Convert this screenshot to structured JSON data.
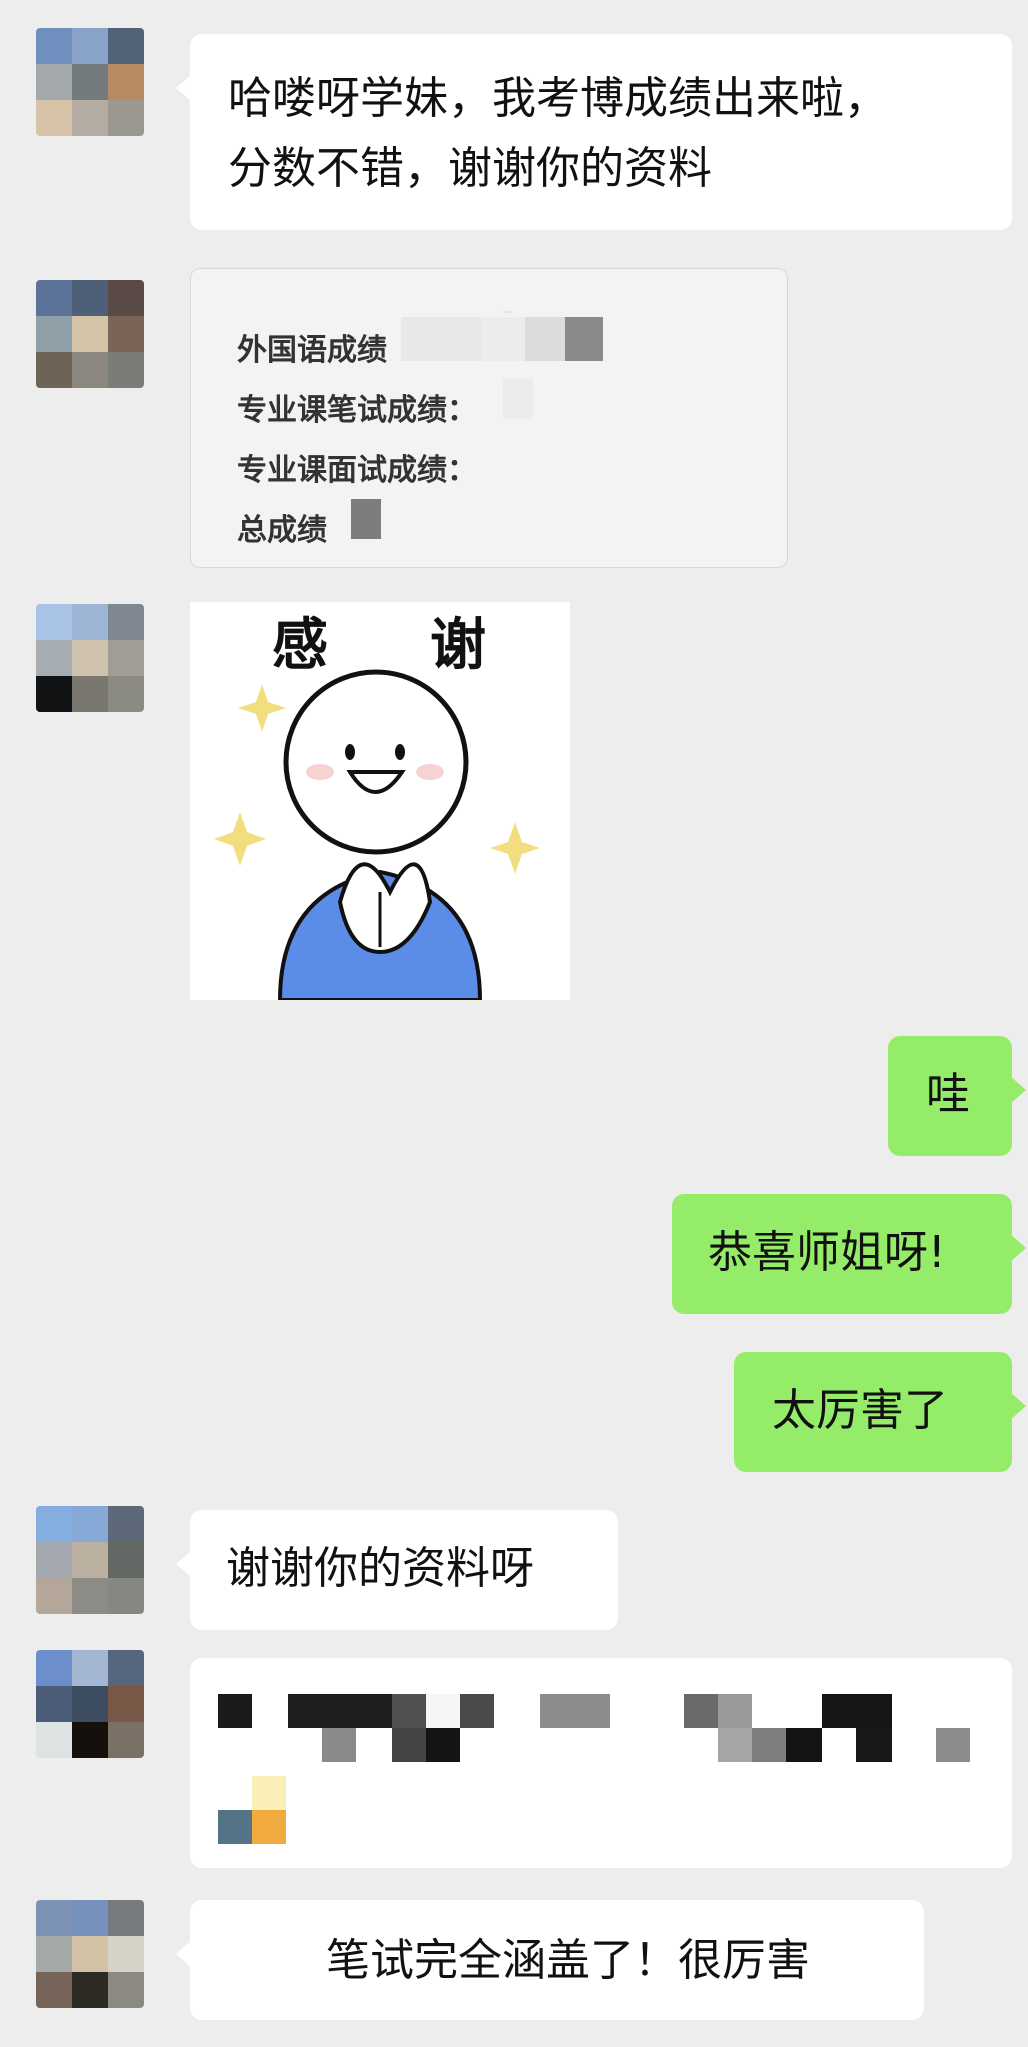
{
  "messages": {
    "m1": {
      "text_line1": "哈喽呀学妹，我考博成绩出来啦，",
      "text_line2": "分数不错，谢谢你的资料"
    },
    "m2": {
      "card_lines": [
        "外国语成绩",
        "专业课笔试成绩：",
        "专业课面试成绩：",
        "总成绩"
      ]
    },
    "m3": {
      "sticker_title_left": "感",
      "sticker_title_right": "谢"
    },
    "m4": {
      "text": "哇"
    },
    "m5": {
      "text": "恭喜师姐呀!"
    },
    "m6": {
      "text": "太厉害了"
    },
    "m7": {
      "text": "谢谢你的资料呀"
    },
    "m9": {
      "text": "笔试完全涵盖了！很厉害"
    }
  },
  "colors": {
    "background": "#ededed",
    "bubble_other": "#ffffff",
    "bubble_self": "#95ec69"
  },
  "icons": {
    "avatar": "pixelated-avatar",
    "sticker": "thank-you-sticker"
  }
}
